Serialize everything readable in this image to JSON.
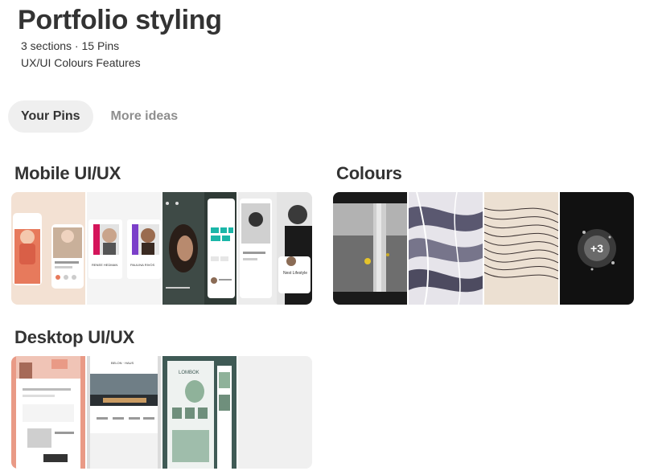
{
  "board": {
    "title": "Portfolio styling",
    "meta": "3 sections · 15 Pins",
    "description": "UX/UI Colours Features"
  },
  "tabs": [
    {
      "label": "Your Pins",
      "active": true
    },
    {
      "label": "More ideas",
      "active": false
    }
  ],
  "sections": [
    {
      "title": "Mobile UI/UX"
    },
    {
      "title": "Colours",
      "more_count": "+3"
    },
    {
      "title": "Desktop UI/UX"
    }
  ],
  "thumbnail_text": {
    "m2_name_a": "RENEE HEDMAN",
    "m2_name_b": "PAULINA RIVOS",
    "m4_label": "Nest Lifestyle",
    "d2_brand": "BELON · HAUS",
    "d3_brand": "LOMBOK"
  },
  "colors": {
    "text_primary": "#333333",
    "text_muted": "#8e8e8e",
    "tab_active_bg": "#efefef",
    "placeholder_tile": "#f0f0f0"
  }
}
